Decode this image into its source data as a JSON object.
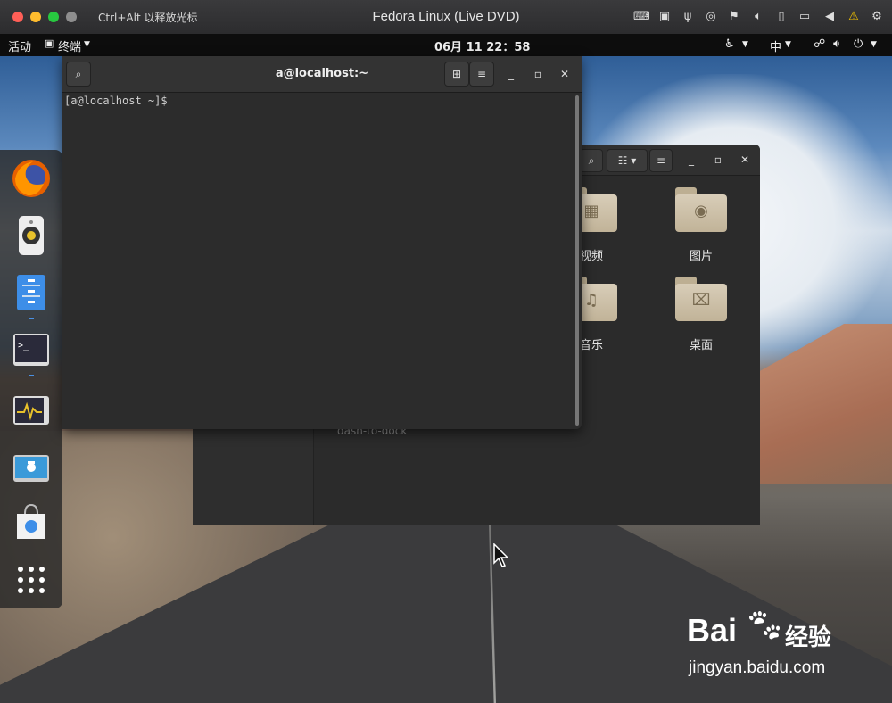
{
  "host": {
    "hint": "Ctrl+Alt 以释放光标",
    "title": "Fedora Linux (Live DVD)",
    "status_icons": [
      "keyboard-icon",
      "cpu-icon",
      "usb-icon",
      "disc-icon",
      "network-off-icon",
      "volume-icon",
      "device-icon",
      "camera-icon",
      "back-icon",
      "warning-icon",
      "gear-icon"
    ]
  },
  "topbar": {
    "activities": "活动",
    "app_menu": "终端",
    "clock": "06月 11  22：58",
    "input_method": "中"
  },
  "dock": {
    "apps": [
      "firefox",
      "rhythmbox",
      "files",
      "terminal",
      "system-monitor",
      "screenshot",
      "software",
      "show-apps"
    ]
  },
  "files": {
    "folders": [
      {
        "label": "视频",
        "glyph": "▦"
      },
      {
        "label": "图片",
        "glyph": "◉"
      },
      {
        "label": "音乐",
        "glyph": "♫"
      },
      {
        "label": "桌面",
        "glyph": "⌧"
      }
    ],
    "dash_text": "dash-to-dock"
  },
  "terminal": {
    "title": "a@localhost:~",
    "prompt": "[a@localhost ~]$"
  },
  "watermark": {
    "brand": "Bai",
    "brand2": "经验",
    "url": "jingyan.baidu.com"
  }
}
